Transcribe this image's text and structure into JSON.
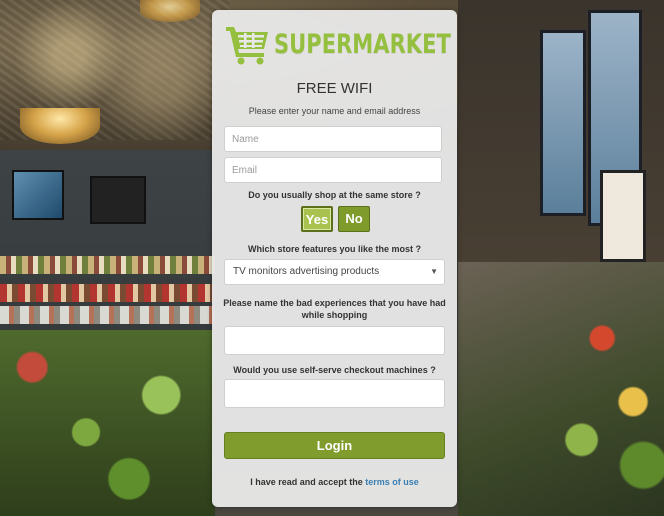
{
  "brand": {
    "name": "SUPERMARKET",
    "icon": "shopping-cart-icon",
    "color": "#95bf3f"
  },
  "form": {
    "title": "FREE WIFI",
    "subtitle": "Please enter your name and email address",
    "name_placeholder": "Name",
    "email_placeholder": "Email",
    "q_same_store": "Do you usually shop at the same store ?",
    "yes_label": "Yes",
    "no_label": "No",
    "selected_answer": "Yes",
    "q_features": "Which store features you like the most ?",
    "features_selected": "TV monitors advertising products",
    "q_bad_experiences": "Please name the bad experiences that you have had while shopping",
    "bad_experiences_value": "",
    "q_self_checkout": "Would you use self-serve checkout machines ?",
    "self_checkout_value": "",
    "login_label": "Login",
    "terms_prefix": "I have read and accept the",
    "terms_link": "terms of use"
  },
  "colors": {
    "accent": "#7f9c2c",
    "link": "#3a7fb3"
  }
}
